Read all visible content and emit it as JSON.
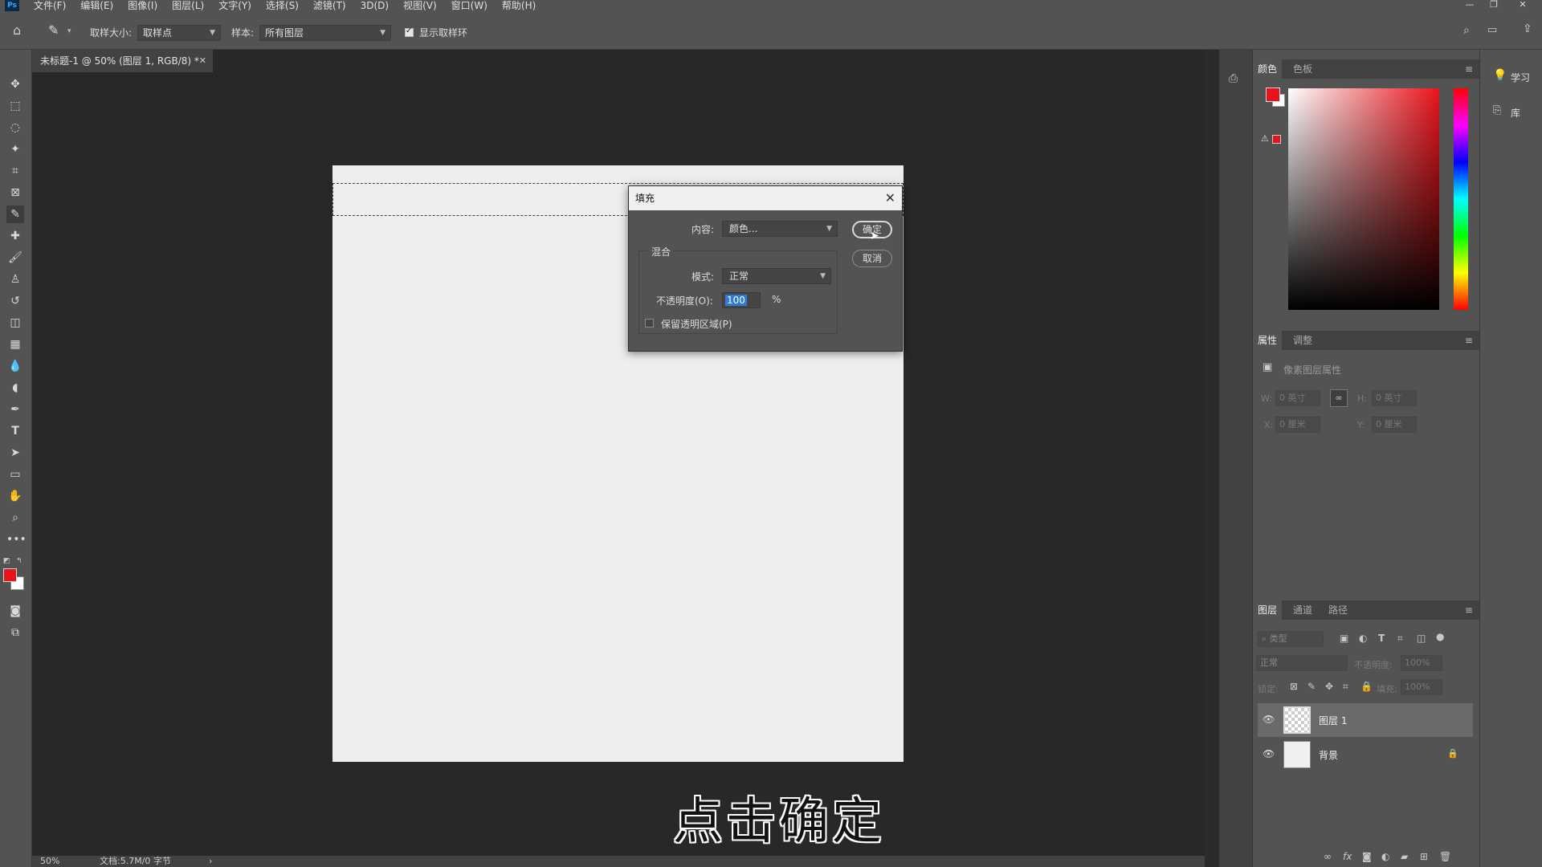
{
  "menubar": {
    "logo": "Ps",
    "items": [
      "文件(F)",
      "编辑(E)",
      "图像(I)",
      "图层(L)",
      "文字(Y)",
      "选择(S)",
      "滤镜(T)",
      "3D(D)",
      "视图(V)",
      "窗口(W)",
      "帮助(H)"
    ]
  },
  "options": {
    "sample_size_label": "取样大小:",
    "sample_size_value": "取样点",
    "sample_label": "样本:",
    "sample_value": "所有图层",
    "show_ring_label": "显示取样环",
    "show_ring_checked": true
  },
  "document": {
    "tab_title": "未标题-1 @ 50% (图层 1, RGB/8) *",
    "zoom": "50%",
    "doc_info": "文档:5.7M/0 字节"
  },
  "subtitle": "点击确定",
  "dialog": {
    "title": "填充",
    "content_label": "内容:",
    "content_value": "颜色...",
    "blend_group": "混合",
    "mode_label": "模式:",
    "mode_value": "正常",
    "opacity_label": "不透明度(O):",
    "opacity_value": "100",
    "opacity_unit": "%",
    "preserve_label": "保留透明区域(P)",
    "preserve_checked": false,
    "ok_label": "确定",
    "cancel_label": "取消"
  },
  "color_panel": {
    "tabs": [
      "颜色",
      "色板"
    ],
    "foreground": "#e8141b",
    "background": "#ffffff"
  },
  "properties_panel": {
    "tabs": [
      "属性",
      "调整"
    ],
    "title": "像素图层属性",
    "w_label": "W:",
    "w_value": "0 英寸",
    "h_label": "H:",
    "h_value": "0 英寸",
    "x_label": "X:",
    "x_value": "0 厘米",
    "y_label": "Y:",
    "y_value": "0 厘米"
  },
  "layers_panel": {
    "tabs": [
      "图层",
      "通道",
      "路径"
    ],
    "filter_placeholder": "类型",
    "blend_mode": "正常",
    "opacity_label": "不透明度:",
    "opacity_value": "100%",
    "lock_label": "锁定:",
    "fill_label": "填充:",
    "fill_value": "100%",
    "layers": [
      {
        "name": "图层 1",
        "selected": true,
        "locked": false
      },
      {
        "name": "背景",
        "selected": false,
        "locked": true
      }
    ]
  },
  "far_right": {
    "learn_label": "学习",
    "library_label": "库"
  }
}
